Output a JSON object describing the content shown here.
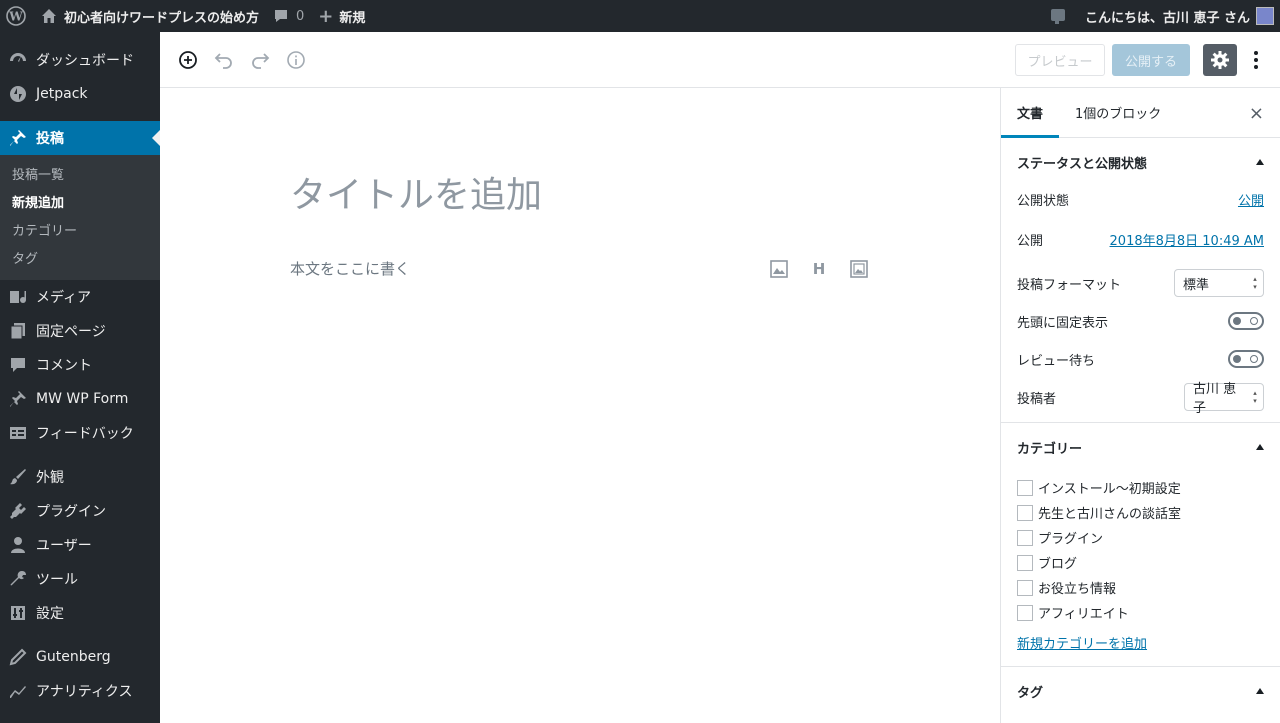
{
  "adminbar": {
    "site_name": "初心者向けワードプレスの始め方",
    "comments_count": "0",
    "new_label": "新規",
    "greeting": "こんにちは、古川 恵子 さん"
  },
  "sidebar": {
    "items": [
      {
        "label": "ダッシュボード",
        "icon": "dashboard-icon"
      },
      {
        "label": "Jetpack",
        "icon": "jetpack-icon"
      },
      {
        "label": "投稿",
        "icon": "pin-icon"
      },
      {
        "label": "メディア",
        "icon": "media-icon"
      },
      {
        "label": "固定ページ",
        "icon": "page-icon"
      },
      {
        "label": "コメント",
        "icon": "comment-icon"
      },
      {
        "label": "MW WP Form",
        "icon": "pin-icon"
      },
      {
        "label": "フィードバック",
        "icon": "feedback-icon"
      },
      {
        "label": "外観",
        "icon": "brush-icon"
      },
      {
        "label": "プラグイン",
        "icon": "plugin-icon"
      },
      {
        "label": "ユーザー",
        "icon": "user-icon"
      },
      {
        "label": "ツール",
        "icon": "wrench-icon"
      },
      {
        "label": "設定",
        "icon": "settings-icon"
      },
      {
        "label": "Gutenberg",
        "icon": "pencil-icon"
      },
      {
        "label": "アナリティクス",
        "icon": "analytics-icon"
      }
    ],
    "submenu": [
      "投稿一覧",
      "新規追加",
      "カテゴリー",
      "タグ"
    ]
  },
  "toolbar": {
    "preview_label": "プレビュー",
    "publish_label": "公開する"
  },
  "editor": {
    "title_placeholder": "タイトルを追加",
    "body_placeholder": "本文をここに書く",
    "heading_icon_label": "H"
  },
  "panel": {
    "tab_document": "文書",
    "tab_block": "1個のブロック",
    "close": "×",
    "status": {
      "heading": "ステータスと公開状態",
      "visibility_label": "公開状態",
      "visibility_value": "公開",
      "publish_label": "公開",
      "publish_value": "2018年8月8日 10:49 AM",
      "format_label": "投稿フォーマット",
      "format_value": "標準",
      "sticky_label": "先頭に固定表示",
      "pending_label": "レビュー待ち",
      "author_label": "投稿者",
      "author_value": "古川 恵子"
    },
    "categories": {
      "heading": "カテゴリー",
      "items": [
        "インストール〜初期設定",
        "先生と古川さんの談話室",
        "プラグイン",
        "ブログ",
        "お役立ち情報",
        "アフィリエイト"
      ],
      "add_link": "新規カテゴリーを追加"
    },
    "tags": {
      "heading": "タグ"
    }
  },
  "colors": {
    "adminbar": "#23282d",
    "accent": "#0073aa",
    "publish_disabled": "#a4c6da"
  }
}
